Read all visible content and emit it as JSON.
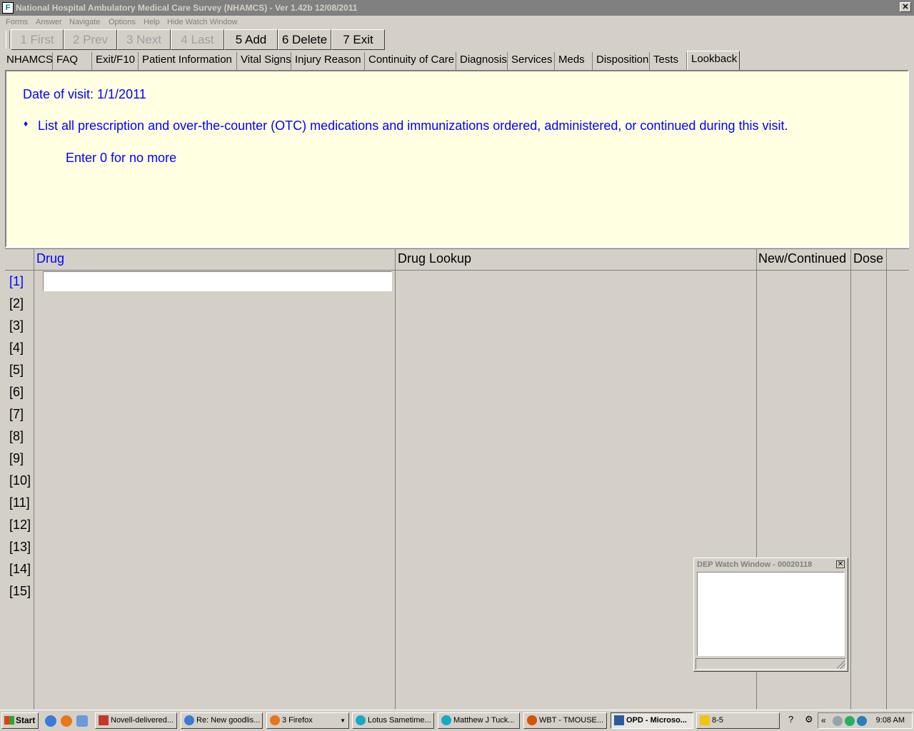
{
  "window": {
    "title": "National Hospital Ambulatory Medical Care Survey (NHAMCS) - Ver 1.42b 12/08/2011",
    "close_glyph": "✕"
  },
  "menu": [
    "Forms",
    "Answer",
    "Navigate",
    "Options",
    "Help",
    "Hide Watch Window"
  ],
  "toolbar": {
    "buttons": [
      {
        "label": "1 First",
        "enabled": false
      },
      {
        "label": "2 Prev",
        "enabled": false
      },
      {
        "label": "3 Next",
        "enabled": false
      },
      {
        "label": "4 Last",
        "enabled": false
      },
      {
        "label": "5 Add",
        "enabled": true
      },
      {
        "label": "6 Delete",
        "enabled": true
      },
      {
        "label": "7 Exit",
        "enabled": true
      }
    ]
  },
  "tabs": [
    {
      "label": "NHAMCS"
    },
    {
      "label": "FAQ"
    },
    {
      "label": "Exit/F10"
    },
    {
      "label": "Patient Information"
    },
    {
      "label": "Vital Signs"
    },
    {
      "label": "Injury Reason"
    },
    {
      "label": "Continuity of Care"
    },
    {
      "label": "Diagnosis"
    },
    {
      "label": "Services"
    },
    {
      "label": "Meds"
    },
    {
      "label": "Disposition"
    },
    {
      "label": "Tests"
    },
    {
      "label": "Lookback",
      "active": true
    }
  ],
  "question": {
    "visit_date": "Date of visit: 1/1/2011",
    "bullet": "♦",
    "instruction": "List all prescription and over-the-counter (OTC) medications and immunizations ordered, administered, or continued during this visit.",
    "enter_hint": "Enter 0 for no more",
    "text_color": "#0000ff",
    "background": "#ffffe1"
  },
  "grid": {
    "columns": [
      "Drug",
      "Drug Lookup",
      "New/Continued",
      "Dose"
    ],
    "rows": [
      "[1]",
      "[2]",
      "[3]",
      "[4]",
      "[5]",
      "[6]",
      "[7]",
      "[8]",
      "[9]",
      "[10]",
      "[11]",
      "[12]",
      "[13]",
      "[14]",
      "[15]"
    ],
    "current_row": "[1]",
    "drug_input_value": ""
  },
  "watch_window": {
    "title": "DEP Watch Window - 00020118",
    "close_glyph": "✕"
  },
  "taskbar": {
    "start_label": "Start",
    "quick_launch": [
      "ie-icon",
      "firefox-icon",
      "outlook-icon"
    ],
    "tasks": [
      {
        "label": "Novell-delivered...",
        "icon": "novell-icon"
      },
      {
        "label": "Re: New goodlis...",
        "icon": "ie-icon"
      },
      {
        "label": "3 Firefox",
        "icon": "firefox-icon",
        "has_dropdown": true
      },
      {
        "label": "Lotus Sametime...",
        "icon": "chat-icon"
      },
      {
        "label": "Matthew J Tuck...",
        "icon": "chat-icon"
      },
      {
        "label": "WBT - TMOUSE...",
        "icon": "wbt-icon"
      },
      {
        "label": "OPD - Microso...",
        "icon": "word-icon",
        "active": true
      },
      {
        "label": "8-5",
        "icon": "folder-icon"
      }
    ],
    "clock": "9:08 AM",
    "tray_arrow": "«"
  }
}
